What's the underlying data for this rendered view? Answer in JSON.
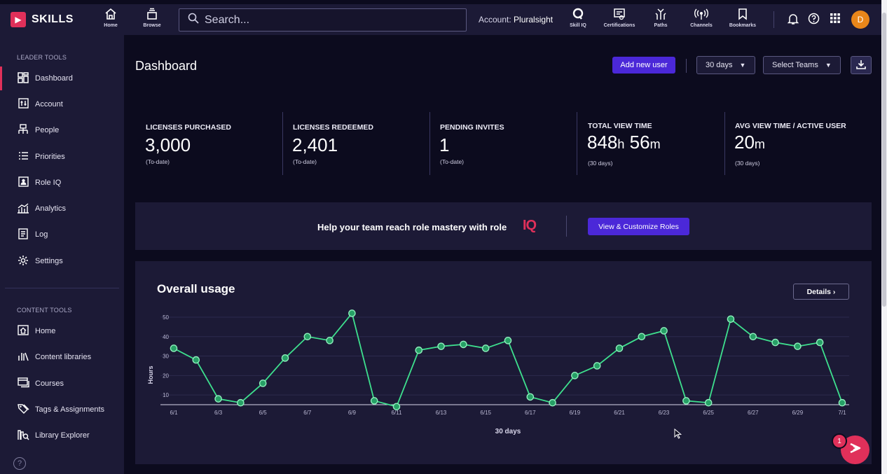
{
  "topnav": {
    "logo_text": "SKILLS",
    "nav": [
      {
        "label": "Home",
        "icon": "home-icon"
      },
      {
        "label": "Browse",
        "icon": "browse-icon"
      }
    ],
    "search_placeholder": "Search...",
    "account_label": "Account:",
    "account_name": "Pluralsight",
    "right_nav": [
      {
        "label": "Skill IQ",
        "icon": "skill-iq-icon"
      },
      {
        "label": "Certifications",
        "icon": "certifications-icon"
      },
      {
        "label": "Paths",
        "icon": "paths-icon"
      },
      {
        "label": "Channels",
        "icon": "channels-icon"
      },
      {
        "label": "Bookmarks",
        "icon": "bookmark-icon"
      }
    ],
    "avatar_initial": "D"
  },
  "sidebar": {
    "leader_title": "LEADER TOOLS",
    "leader_items": [
      {
        "label": "Dashboard",
        "icon": "dashboard-icon",
        "active": true
      },
      {
        "label": "Account",
        "icon": "account-icon"
      },
      {
        "label": "People",
        "icon": "people-icon"
      },
      {
        "label": "Priorities",
        "icon": "priorities-icon"
      },
      {
        "label": "Role IQ",
        "icon": "role-iq-icon"
      },
      {
        "label": "Analytics",
        "icon": "analytics-icon"
      },
      {
        "label": "Log",
        "icon": "log-icon"
      },
      {
        "label": "Settings",
        "icon": "gear-icon"
      }
    ],
    "content_title": "CONTENT TOOLS",
    "content_items": [
      {
        "label": "Home",
        "icon": "home-icon"
      },
      {
        "label": "Content libraries",
        "icon": "libraries-icon"
      },
      {
        "label": "Courses",
        "icon": "courses-icon"
      },
      {
        "label": "Tags & Assignments",
        "icon": "tags-icon"
      },
      {
        "label": "Library Explorer",
        "icon": "library-explorer-icon"
      }
    ]
  },
  "dashboard": {
    "title": "Dashboard",
    "add_user": "Add new user",
    "range": "30 days",
    "teams": "Select Teams"
  },
  "stats": [
    {
      "label": "LICENSES PURCHASED",
      "value": "3,000",
      "sub": "(To-date)"
    },
    {
      "label": "LICENSES REDEEMED",
      "value": "2,401",
      "sub": "(To-date)"
    },
    {
      "label": "PENDING INVITES",
      "value": "1",
      "sub": "(To-date)"
    },
    {
      "label": "TOTAL VIEW TIME",
      "value_h": "848",
      "unit_h": "h",
      "value_m": "56",
      "unit_m": "m",
      "sub": "(30 days)"
    },
    {
      "label": "AVG VIEW TIME / ACTIVE USER",
      "value_m": "20",
      "unit_m": "m",
      "sub": "(30 days)"
    }
  ],
  "banner": {
    "text": "Help your team reach role mastery with role",
    "iq": "IQ",
    "button": "View & Customize Roles"
  },
  "usage": {
    "title": "Overall usage",
    "details": "Details"
  },
  "notification_count": "1",
  "colors": {
    "accent": "#e0305a",
    "primary": "#4b28d8",
    "line": "#3ee08e"
  },
  "chart_data": {
    "type": "line",
    "title": "Overall usage",
    "xlabel": "30 days",
    "ylabel": "Hours",
    "ylim": [
      5,
      50
    ],
    "yticks": [
      10,
      20,
      30,
      40,
      50
    ],
    "x": [
      "6/1",
      "6/2",
      "6/3",
      "6/4",
      "6/5",
      "6/6",
      "6/7",
      "6/8",
      "6/9",
      "6/10",
      "6/11",
      "6/12",
      "6/13",
      "6/14",
      "6/15",
      "6/16",
      "6/17",
      "6/18",
      "6/19",
      "6/20",
      "6/21",
      "6/22",
      "6/23",
      "6/24",
      "6/25",
      "6/26",
      "6/27",
      "6/28",
      "6/29",
      "6/30",
      "7/1"
    ],
    "xtick_labels": [
      "6/1",
      "6/3",
      "6/5",
      "6/7",
      "6/9",
      "6/11",
      "6/13",
      "6/15",
      "6/17",
      "6/19",
      "6/21",
      "6/23",
      "6/25",
      "6/27",
      "6/29",
      "7/1"
    ],
    "series": [
      {
        "values": [
          34,
          28,
          8,
          6,
          16,
          29,
          40,
          38,
          52,
          7,
          4,
          33,
          35,
          36,
          34,
          38,
          9,
          6,
          20,
          25,
          34,
          40,
          43,
          7,
          6,
          49,
          40,
          37,
          35,
          37,
          6
        ]
      }
    ]
  }
}
